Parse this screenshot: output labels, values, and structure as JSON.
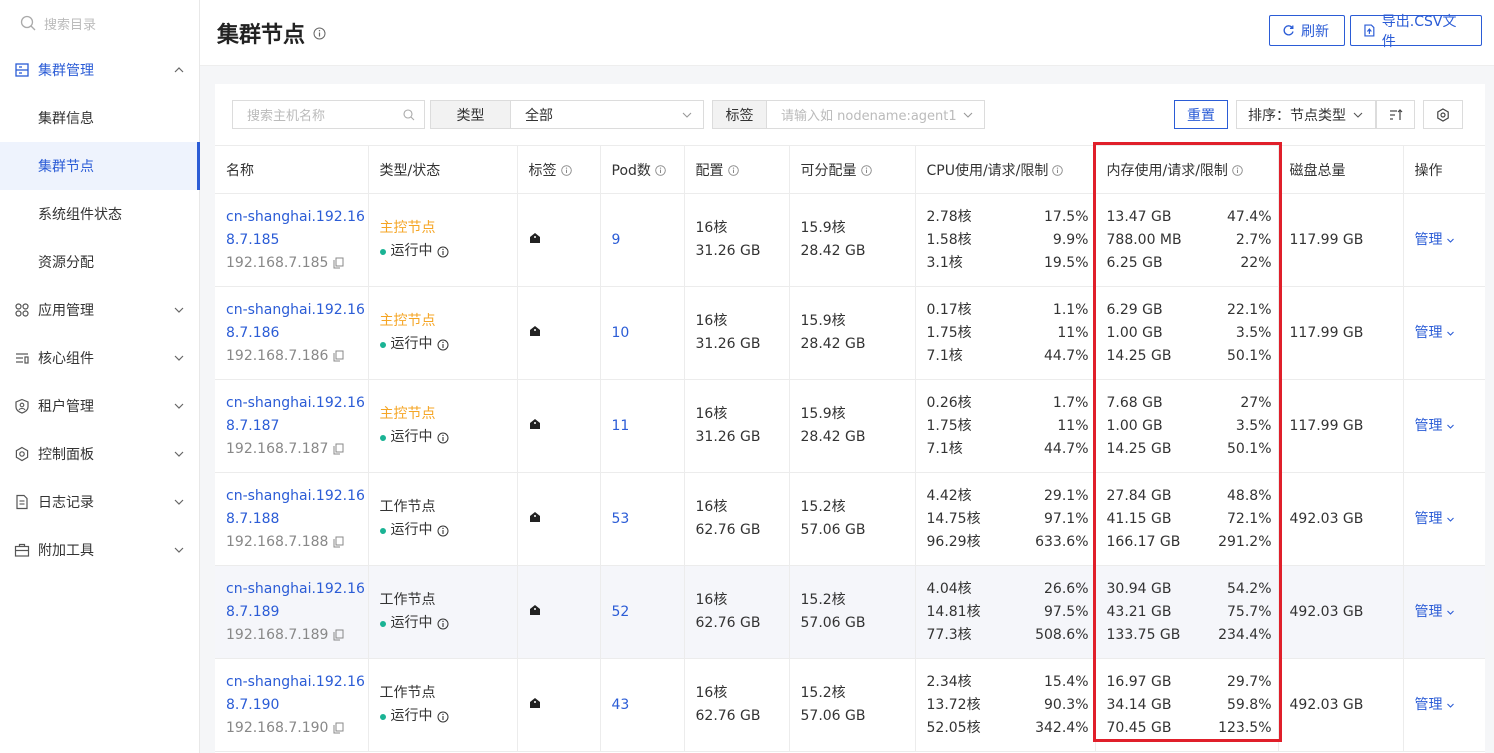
{
  "sidebar": {
    "search_placeholder": "搜索目录",
    "groups": [
      {
        "label": "集群管理",
        "icon": "server-icon",
        "expanded": true
      },
      {
        "label": "应用管理",
        "icon": "apps-icon"
      },
      {
        "label": "核心组件",
        "icon": "components-icon"
      },
      {
        "label": "租户管理",
        "icon": "tenant-icon"
      },
      {
        "label": "控制面板",
        "icon": "settings-icon"
      },
      {
        "label": "日志记录",
        "icon": "log-icon"
      },
      {
        "label": "附加工具",
        "icon": "toolbox-icon"
      }
    ],
    "subitems": [
      "集群信息",
      "集群节点",
      "系统组件状态",
      "资源分配"
    ],
    "active_subitem": "集群节点"
  },
  "header": {
    "title": "集群节点",
    "refresh_label": "刷新",
    "export_label": "导出.CSV文件"
  },
  "toolbar": {
    "search_placeholder": "搜索主机名称",
    "type_label": "类型",
    "type_value": "全部",
    "tag_label": "标签",
    "tag_placeholder": "请输入如 nodename:agent1",
    "reset_label": "重置",
    "sort_label": "排序：节点类型"
  },
  "table": {
    "columns": [
      "名称",
      "类型/状态",
      "标签",
      "Pod数",
      "配置",
      "可分配量",
      "CPU使用/请求/限制",
      "内存使用/请求/限制",
      "磁盘总量",
      "操作"
    ],
    "rows": [
      {
        "name_1": "cn-shanghai.192.16",
        "name_2": "8.7.185",
        "ip": "192.168.7.185",
        "type": "主控节点",
        "status": "运行中",
        "pods": "9",
        "cfg_cpu": "16核",
        "cfg_mem": "31.26 GB",
        "alloc_cpu": "15.9核",
        "alloc_mem": "28.42 GB",
        "cpu": [
          [
            "2.78核",
            "17.5%"
          ],
          [
            "1.58核",
            "9.9%"
          ],
          [
            "3.1核",
            "19.5%"
          ]
        ],
        "mem": [
          [
            "13.47 GB",
            "47.4%"
          ],
          [
            "788.00 MB",
            "2.7%"
          ],
          [
            "6.25 GB",
            "22%"
          ]
        ],
        "disk": "117.99 GB",
        "op": "管理"
      },
      {
        "name_1": "cn-shanghai.192.16",
        "name_2": "8.7.186",
        "ip": "192.168.7.186",
        "type": "主控节点",
        "status": "运行中",
        "pods": "10",
        "cfg_cpu": "16核",
        "cfg_mem": "31.26 GB",
        "alloc_cpu": "15.9核",
        "alloc_mem": "28.42 GB",
        "cpu": [
          [
            "0.17核",
            "1.1%"
          ],
          [
            "1.75核",
            "11%"
          ],
          [
            "7.1核",
            "44.7%"
          ]
        ],
        "mem": [
          [
            "6.29 GB",
            "22.1%"
          ],
          [
            "1.00 GB",
            "3.5%"
          ],
          [
            "14.25 GB",
            "50.1%"
          ]
        ],
        "disk": "117.99 GB",
        "op": "管理"
      },
      {
        "name_1": "cn-shanghai.192.16",
        "name_2": "8.7.187",
        "ip": "192.168.7.187",
        "type": "主控节点",
        "status": "运行中",
        "pods": "11",
        "cfg_cpu": "16核",
        "cfg_mem": "31.26 GB",
        "alloc_cpu": "15.9核",
        "alloc_mem": "28.42 GB",
        "cpu": [
          [
            "0.26核",
            "1.7%"
          ],
          [
            "1.75核",
            "11%"
          ],
          [
            "7.1核",
            "44.7%"
          ]
        ],
        "mem": [
          [
            "7.68 GB",
            "27%"
          ],
          [
            "1.00 GB",
            "3.5%"
          ],
          [
            "14.25 GB",
            "50.1%"
          ]
        ],
        "disk": "117.99 GB",
        "op": "管理"
      },
      {
        "name_1": "cn-shanghai.192.16",
        "name_2": "8.7.188",
        "ip": "192.168.7.188",
        "type": "工作节点",
        "status": "运行中",
        "pods": "53",
        "cfg_cpu": "16核",
        "cfg_mem": "62.76 GB",
        "alloc_cpu": "15.2核",
        "alloc_mem": "57.06 GB",
        "cpu": [
          [
            "4.42核",
            "29.1%"
          ],
          [
            "14.75核",
            "97.1%"
          ],
          [
            "96.29核",
            "633.6%"
          ]
        ],
        "mem": [
          [
            "27.84 GB",
            "48.8%"
          ],
          [
            "41.15 GB",
            "72.1%"
          ],
          [
            "166.17 GB",
            "291.2%"
          ]
        ],
        "disk": "492.03 GB",
        "op": "管理"
      },
      {
        "name_1": "cn-shanghai.192.16",
        "name_2": "8.7.189",
        "ip": "192.168.7.189",
        "type": "工作节点",
        "status": "运行中",
        "pods": "52",
        "cfg_cpu": "16核",
        "cfg_mem": "62.76 GB",
        "alloc_cpu": "15.2核",
        "alloc_mem": "57.06 GB",
        "cpu": [
          [
            "4.04核",
            "26.6%"
          ],
          [
            "14.81核",
            "97.5%"
          ],
          [
            "77.3核",
            "508.6%"
          ]
        ],
        "mem": [
          [
            "30.94 GB",
            "54.2%"
          ],
          [
            "43.21 GB",
            "75.7%"
          ],
          [
            "133.75 GB",
            "234.4%"
          ]
        ],
        "disk": "492.03 GB",
        "op": "管理"
      },
      {
        "name_1": "cn-shanghai.192.16",
        "name_2": "8.7.190",
        "ip": "192.168.7.190",
        "type": "工作节点",
        "status": "运行中",
        "pods": "43",
        "cfg_cpu": "16核",
        "cfg_mem": "62.76 GB",
        "alloc_cpu": "15.2核",
        "alloc_mem": "57.06 GB",
        "cpu": [
          [
            "2.34核",
            "15.4%"
          ],
          [
            "13.72核",
            "90.3%"
          ],
          [
            "52.05核",
            "342.4%"
          ]
        ],
        "mem": [
          [
            "16.97 GB",
            "29.7%"
          ],
          [
            "34.14 GB",
            "59.8%"
          ],
          [
            "70.45 GB",
            "123.5%"
          ]
        ],
        "disk": "492.03 GB",
        "op": "管理"
      }
    ]
  },
  "colors": {
    "accent": "#2b5cd6",
    "master": "#f5a524",
    "running": "#1ab394",
    "highlight_box": "#e01f2a"
  }
}
